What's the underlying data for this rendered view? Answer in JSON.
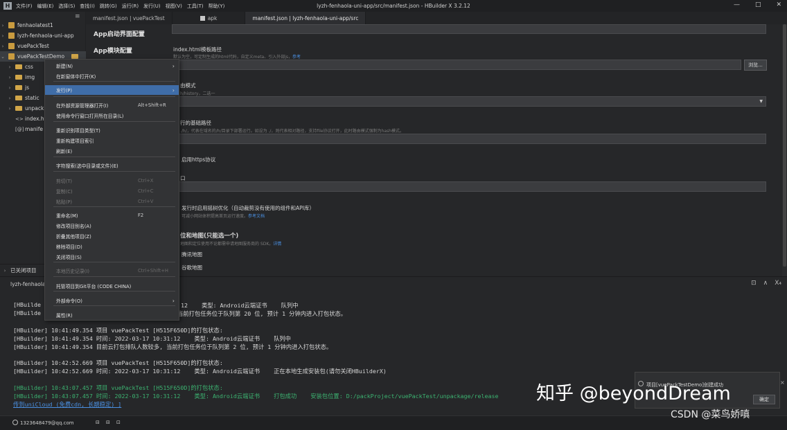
{
  "titlebar": {
    "logo": "H",
    "menus": [
      "文件(F)",
      "编辑(E)",
      "选择(S)",
      "查找(I)",
      "跳转(G)",
      "运行(R)",
      "发行(U)",
      "视图(V)",
      "工具(T)",
      "帮助(Y)"
    ],
    "window_title": "lyzh-fenhaola-uni-app/src/manifest.json - HBuilder X 3.2.12",
    "controls": [
      "—",
      "□",
      "✕"
    ]
  },
  "sidebar": {
    "toolbar_icon": "≡",
    "projects": [
      {
        "caret": "›",
        "label": "fenhaolatest1"
      },
      {
        "caret": "›",
        "label": "lyzh-fenhaola-uni-app"
      },
      {
        "caret": "›",
        "label": "vuePackTest"
      },
      {
        "caret": "⌄",
        "label": "vuePackTestDemo"
      }
    ],
    "children": [
      {
        "caret": "›",
        "type": "folder",
        "label": "css"
      },
      {
        "caret": "›",
        "type": "folder",
        "label": "img"
      },
      {
        "caret": "›",
        "type": "folder",
        "label": "js"
      },
      {
        "caret": "›",
        "type": "folder",
        "label": "static"
      },
      {
        "caret": "›",
        "type": "folder",
        "label": "unpack"
      },
      {
        "caret": "",
        "type": "file",
        "icon": "<>",
        "label": "index.h"
      },
      {
        "caret": "",
        "type": "file",
        "icon": "[@]",
        "label": "manife"
      }
    ],
    "closed_projects": "已关闭项目"
  },
  "tabs": [
    {
      "label": "manifest.json | vuePackTest",
      "active": false
    },
    {
      "label": "apk",
      "active": false
    },
    {
      "label": "manifest.json | lyzh-fenhaola-uni-app/src",
      "active": true
    }
  ],
  "manifest_nav": [
    "App启动界面配置",
    "App模块配置"
  ],
  "editor": {
    "index_template_label": "index.html模板路径",
    "index_template_hint": "默认为空，可定制生成的html代码，自定义meta、引入外部js，",
    "index_template_link": "参考",
    "browse_button": "浏览...",
    "router_mode_label": "由模式",
    "router_mode_hint": "h/history，二选一",
    "base_path_label": "行的基础路径",
    "base_path_hint": "./h/，代表在域名的/h/目录下部署运行。如设为 ./，则代表相对路径，支持file协议打开，此时路由模式强制为hash模式。",
    "https_label": "启用https协议",
    "port_label": "口",
    "treeshake_label": "发行时启用摇树优化（自动裁剪没有使用的组件和API库）",
    "treeshake_hint": "可减小网站体积提高首页运行速度。",
    "treeshake_link": "参考文档",
    "map_label": "位和地图(只能选一个)",
    "map_hint": "地图和定位使用不论都需申请地图服务商的 SDK。",
    "map_link": "详情",
    "map_option1": "腾讯地图",
    "map_option2": "谷歌地图"
  },
  "context_menu": {
    "items": [
      {
        "label": "新建(N)",
        "shortcut": "",
        "arrow": "›",
        "state": "normal"
      },
      {
        "label": "在新窗体中打开(K)",
        "shortcut": "",
        "arrow": "",
        "state": "normal"
      },
      {
        "label": "发行(P)",
        "shortcut": "",
        "arrow": "›",
        "state": "highlight"
      },
      {
        "label": "在外部资源管理器打开(I)",
        "shortcut": "Alt+Shift+R",
        "arrow": "",
        "state": "normal"
      },
      {
        "label": "使用命令行窗口打开所在目录(L)",
        "shortcut": "",
        "arrow": "",
        "state": "normal"
      },
      {
        "label": "重新识别项目类型(T)",
        "shortcut": "",
        "arrow": "",
        "state": "normal"
      },
      {
        "label": "重新构建项目索引",
        "shortcut": "",
        "arrow": "",
        "state": "normal"
      },
      {
        "label": "刷新(E)",
        "shortcut": "",
        "arrow": "",
        "state": "normal"
      },
      {
        "label": "字符搜索(选中目录或文件)(E)",
        "shortcut": "",
        "arrow": "",
        "state": "normal"
      },
      {
        "label": "剪切(T)",
        "shortcut": "Ctrl+X",
        "arrow": "",
        "state": "disabled"
      },
      {
        "label": "复制(C)",
        "shortcut": "Ctrl+C",
        "arrow": "",
        "state": "disabled"
      },
      {
        "label": "粘贴(P)",
        "shortcut": "Ctrl+V",
        "arrow": "",
        "state": "disabled"
      },
      {
        "label": "重命名(M)",
        "shortcut": "F2",
        "arrow": "",
        "state": "normal"
      },
      {
        "label": "修改项目别名(A)",
        "shortcut": "",
        "arrow": "",
        "state": "normal"
      },
      {
        "label": "折叠其他项目(Z)",
        "shortcut": "",
        "arrow": "",
        "state": "normal"
      },
      {
        "label": "移除项目(D)",
        "shortcut": "",
        "arrow": "",
        "state": "normal"
      },
      {
        "label": "关闭项目(S)",
        "shortcut": "",
        "arrow": "",
        "state": "normal"
      },
      {
        "label": "本地历史记录(I)",
        "shortcut": "Ctrl+Shift+H",
        "arrow": "",
        "state": "disabled"
      },
      {
        "label": "托管项目到Git平台 (CODE CHINA)",
        "shortcut": "",
        "arrow": "",
        "state": "normal"
      },
      {
        "label": "外部命令(O)",
        "shortcut": "",
        "arrow": "›",
        "state": "normal"
      },
      {
        "label": "属性(R)",
        "shortcut": "",
        "arrow": "",
        "state": "normal"
      }
    ]
  },
  "console": {
    "title": "lyzh-fenhaola",
    "controls": [
      "⊡",
      "∧",
      "X₄"
    ],
    "lines": [
      {
        "text": "[HBuilde",
        "style": "normal"
      },
      {
        "text": "[HBuilde",
        "style": "normal"
      },
      {
        "text": ":12    类型: Android云端证书    队列中",
        "style": "normal"
      },
      {
        "text": "当前打包任务位于队列第 20 位, 预计 1 分钟内进入打包状态。",
        "style": "normal"
      },
      {
        "text": "[HBuilder] 10:41:49.354 项目 vuePackTest [H515F650D]的打包状态:",
        "style": "normal"
      },
      {
        "text": "[HBuilder] 10:41:49.354 时间: 2022-03-17 10:31:12    类型: Android云端证书    队列中",
        "style": "normal"
      },
      {
        "text": "[HBuilder] 10:41:49.354 目前云打包排队人数较多, 当前打包任务位于队列第 2 位, 预计 1 分钟内进入打包状态。",
        "style": "normal"
      },
      {
        "text": "[HBuilder] 10:42:52.669 项目 vuePackTest [H515F650D]的打包状态:",
        "style": "normal"
      },
      {
        "text": "[HBuilder] 10:42:52.669 时间: 2022-03-17 10:31:12    类型: Android云端证书    正在本地生成安装包(请勿关闭HBuilderX)",
        "style": "normal"
      },
      {
        "text": "[HBuilder] 10:43:07.457 项目 vuePackTest [H515F650D]的打包状态:",
        "style": "green"
      },
      {
        "text": "[HBuilder] 10:43:07.457 时间: 2022-03-17 10:31:12    类型: Android云端证书    打包成功    安装包位置: D:/packProject/vuePackTest/unpackage/release",
        "style": "green"
      },
      {
        "text": "传到uniCloud (免费cdn, 长期稳定) ]",
        "style": "link"
      }
    ]
  },
  "statusbar": {
    "user": "1323648479@qq.com",
    "icons": [
      "⊟",
      "⊟",
      "⊡"
    ]
  },
  "notification": {
    "text": "项目[vuePackTestDemo]创建成功",
    "button": "确定",
    "close": "×"
  },
  "watermarks": {
    "zhihu": "知乎 @beyondDream",
    "csdn": "CSDN @菜鸟娇嗔"
  }
}
